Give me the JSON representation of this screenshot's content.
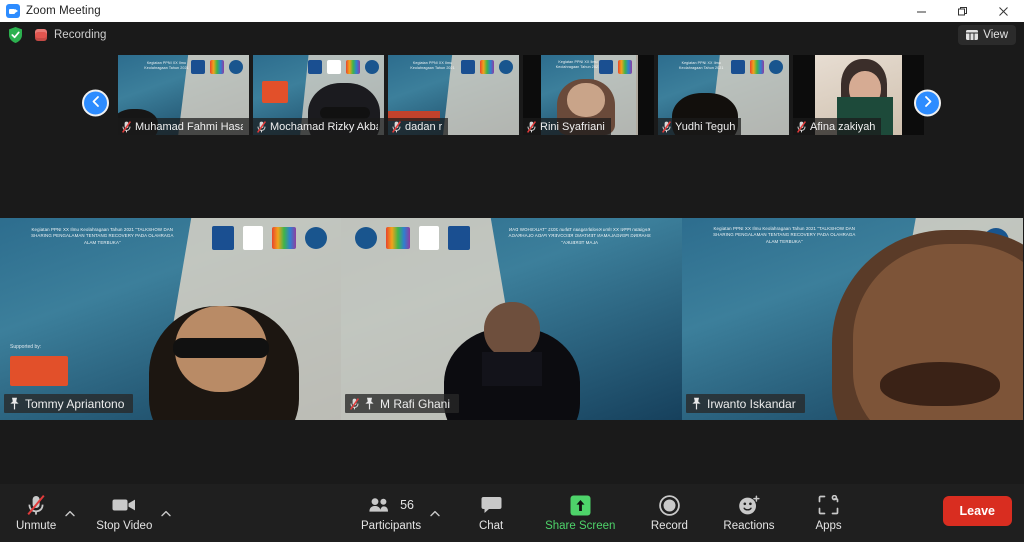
{
  "window": {
    "title": "Zoom Meeting",
    "app_icon": "zoom-logo-icon",
    "minimize_label": "Minimize",
    "maximize_label": "Restore",
    "close_label": "Close"
  },
  "status_bar": {
    "encryption_icon": "green-shield-check-icon",
    "recording_icon": "recording-indicator-icon",
    "recording_label": "Recording",
    "view_icon": "grid-view-icon",
    "view_label": "View"
  },
  "thumbnail_strip": {
    "prev_label": "Previous page",
    "next_label": "Next page",
    "prev_icon": "chevron-left-icon",
    "next_icon": "chevron-right-icon",
    "participants": [
      {
        "name": "Muhamad Fahmi Hasan",
        "muted": true,
        "mic_icon": "mic-muted-icon"
      },
      {
        "name": "Mochamad Rizky Akbari",
        "muted": true,
        "mic_icon": "mic-muted-icon"
      },
      {
        "name": "dadan r",
        "muted": true,
        "mic_icon": "mic-muted-icon"
      },
      {
        "name": "Rini Syafriani",
        "muted": true,
        "mic_icon": "mic-muted-icon"
      },
      {
        "name": "Yudhi Teguh",
        "muted": true,
        "mic_icon": "mic-muted-icon"
      },
      {
        "name": "Afina zakiyah",
        "muted": true,
        "mic_icon": "mic-muted-icon"
      }
    ]
  },
  "video_grid": {
    "backdrop_text": "Kegiatan PPNI XX Ilmu Keolahragaan Tahun 2021 \"TALKSHOW DAN SHARING PENGALAMAN TENTANG RECOVERY PADA OLAHRAGA ALAM TERBUKA\"",
    "tiles": [
      {
        "name": "Tommy Apriantono",
        "pinned": true,
        "muted": false,
        "active_speaker": false,
        "pin_icon": "pin-icon"
      },
      {
        "name": "M Rafi Ghani",
        "pinned": true,
        "muted": true,
        "active_speaker": false,
        "pin_icon": "pin-icon",
        "mic_icon": "mic-muted-icon"
      },
      {
        "name": "Irwanto Iskandar",
        "pinned": true,
        "muted": false,
        "active_speaker": true,
        "pin_icon": "pin-icon"
      }
    ]
  },
  "toolbar": {
    "audio": {
      "label": "Unmute",
      "icon": "mic-muted-icon",
      "caret_icon": "chevron-up-icon"
    },
    "video": {
      "label": "Stop Video",
      "icon": "camera-icon",
      "caret_icon": "chevron-up-icon"
    },
    "participants": {
      "label": "Participants",
      "count": "56",
      "icon": "people-icon",
      "caret_icon": "chevron-up-icon"
    },
    "chat": {
      "label": "Chat",
      "icon": "chat-bubble-icon"
    },
    "share": {
      "label": "Share Screen",
      "icon": "share-screen-icon"
    },
    "record": {
      "label": "Record",
      "icon": "record-circle-icon"
    },
    "reactions": {
      "label": "Reactions",
      "icon": "reactions-smiley-icon"
    },
    "apps": {
      "label": "Apps",
      "icon": "apps-icon"
    },
    "leave": {
      "label": "Leave"
    }
  },
  "colors": {
    "accent_blue": "#2d8cff",
    "leave_red": "#d92d20",
    "share_green": "#4ed36a",
    "active_speaker_border": "#dfe93f",
    "recording_red": "#e0554f",
    "shield_green": "#2cb14f",
    "window_bg": "#1a1a1a",
    "toolbar_bg": "#1f1f1f"
  }
}
